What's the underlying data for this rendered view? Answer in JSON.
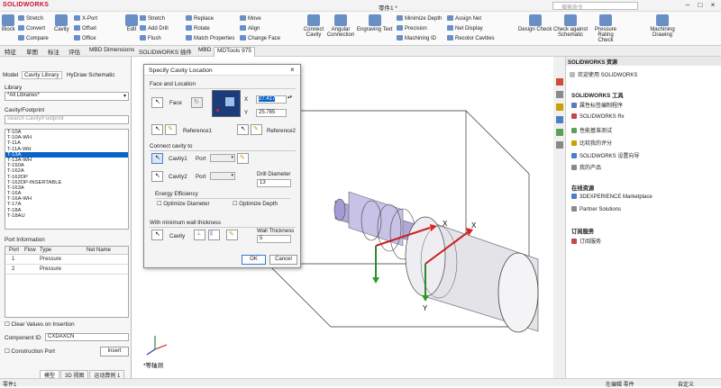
{
  "app": {
    "logo": "SOLIDWORKS",
    "doc_title": "零件1 *",
    "search_placeholder": "搜索命令"
  },
  "ribbon": {
    "block": "Block",
    "cavity": "Cavity",
    "stretch": "Stretch",
    "convert": "Convert",
    "compare": "Compare",
    "xport": "X-Port",
    "offset": "Offset",
    "office": "Office",
    "edit": "Edit",
    "add_drill": "Add Drill",
    "flush": "Flush",
    "stretch2": "Stretch",
    "replace": "Replace",
    "rotate": "Rotate",
    "match_props": "Match Properties",
    "move": "Move",
    "align": "Align",
    "change_face": "Change Face",
    "connect_cavity": "Connect Cavity",
    "angular_connection": "Angular Connection",
    "engraving_text": "Engraving Text",
    "minimize_depth": "Minimize Depth",
    "precision": "Precision",
    "machining_id": "Machining ID",
    "assign_net": "Assign Net",
    "net_display": "Net Display",
    "recolor_cavities": "Recolor Cavities",
    "design_check": "Design Check",
    "check_schematic": "Check against Schematic",
    "pressure_rating": "Pressure Rating Check",
    "machining_drawing": "Machining Drawing"
  },
  "tabs": [
    "特征",
    "草图",
    "标注",
    "评估",
    "MBD Dimensions",
    "SOLIDWORKS 插件",
    "MBD",
    "MDTools 975"
  ],
  "left": {
    "subtabs": [
      "Model",
      "Cavity Library",
      "HyDraw Schematic"
    ],
    "library_label": "Library",
    "library_value": "*All Libraries*",
    "cavity_label": "Cavity/Footprint",
    "search_placeholder": "Search Cavity/Footprint",
    "items": [
      "T-10A",
      "T-10A-WH",
      "T-11A",
      "T-11A-WH",
      "T-13A",
      "T-13A-WH",
      "T-150A",
      "T-162A",
      "T-162DP",
      "T-162DP-INSERTABLE",
      "T-163A",
      "T-16A",
      "T-16A-WH",
      "T-17A",
      "T-18A",
      "T-18AU"
    ],
    "selected": "T-13A",
    "port_info": "Port Information",
    "port_headers": [
      "Port",
      "Flow",
      "Type",
      "Net Name"
    ],
    "port_rows": [
      {
        "port": "1",
        "type": "Pressure"
      },
      {
        "port": "2",
        "type": "Pressure"
      }
    ],
    "clear_values": "Clear Values on Insertion",
    "component_id_label": "Component ID",
    "component_id": "CXDAXCN",
    "construction_port": "Construction Port",
    "insert": "Insert"
  },
  "dialog": {
    "title": "Specify Cavity Location",
    "face_location": "Face and Location",
    "face": "Face",
    "x_label": "X",
    "x_value": "27.417",
    "y_label": "Y",
    "y_value": "25.785",
    "reference1": "Reference1",
    "reference2": "Reference2",
    "connect_to": "Connect cavity to",
    "cavity1": "Cavity1",
    "cavity2": "Cavity2",
    "port": "Port",
    "drill_diameter_label": "Drill Diameter",
    "drill_diameter": "13",
    "energy": "Energy Efficiency",
    "opt_diameter": "Optimize Diameter",
    "opt_depth": "Optimize Depth",
    "min_wall": "With minimum wall thickness",
    "cavity": "Cavity",
    "wall_thickness_label": "Wall Thickness",
    "wall_thickness": "5",
    "ok": "OK",
    "cancel": "Cancel"
  },
  "viewport": {
    "view_label": "*等轴测",
    "axis_x": "X",
    "axis_y": "Y"
  },
  "right": {
    "header": "SOLIDWORKS 资源",
    "welcome": "欢迎使用 SOLIDWORKS",
    "tools_title": "SOLIDWORKS 工具",
    "tools": [
      "属性标签编制程序",
      "SOLIDWORKS Rx",
      "性能基准测试",
      "比较我的评分",
      "SOLIDWORKS 设置向导",
      "我的产品"
    ],
    "online_title": "在线资源",
    "online": [
      "3DEXPERIENCE Marketplace",
      "Partner Solutions"
    ],
    "subscription_title": "订阅服务",
    "subscription": [
      "订阅服务"
    ]
  },
  "bottom_tabs": [
    "模型",
    "3D 视图",
    "运动算例 1"
  ],
  "status": {
    "left": "零件1",
    "editing": "在编辑 零件",
    "custom": "自定义"
  }
}
